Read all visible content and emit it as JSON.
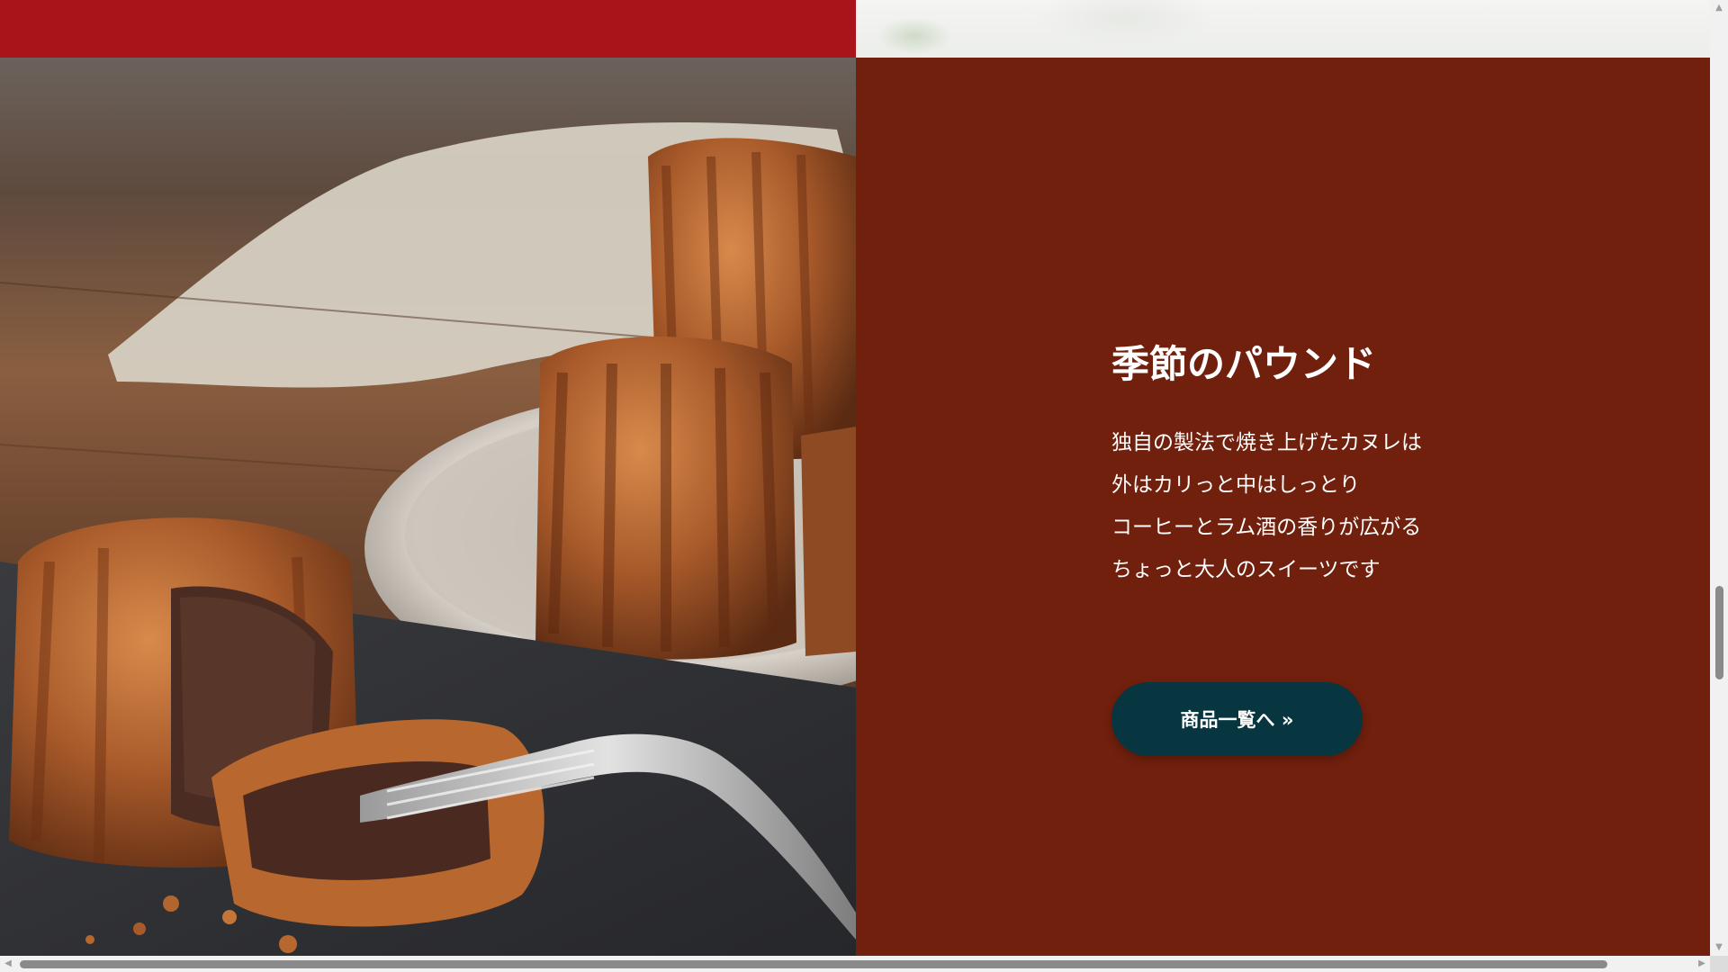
{
  "section": {
    "title": "季節のパウンド",
    "description_lines": [
      "独自の製法で焼き上げたカヌレは",
      "外はカリっと中はしっとり",
      "コーヒーとラム酒の香りが広がる",
      "ちょっと大人のスイーツです"
    ],
    "cta_label": "商品一覧へ »"
  },
  "image": {
    "subject": "canneles"
  },
  "colors": {
    "top_strip": "#a81419",
    "panel_background": "#71200d",
    "button_background": "#073641",
    "text": "#ffffff"
  },
  "scrollbars": {
    "vertical_position": 0.62,
    "horizontal_visible_fraction": 0.93
  }
}
